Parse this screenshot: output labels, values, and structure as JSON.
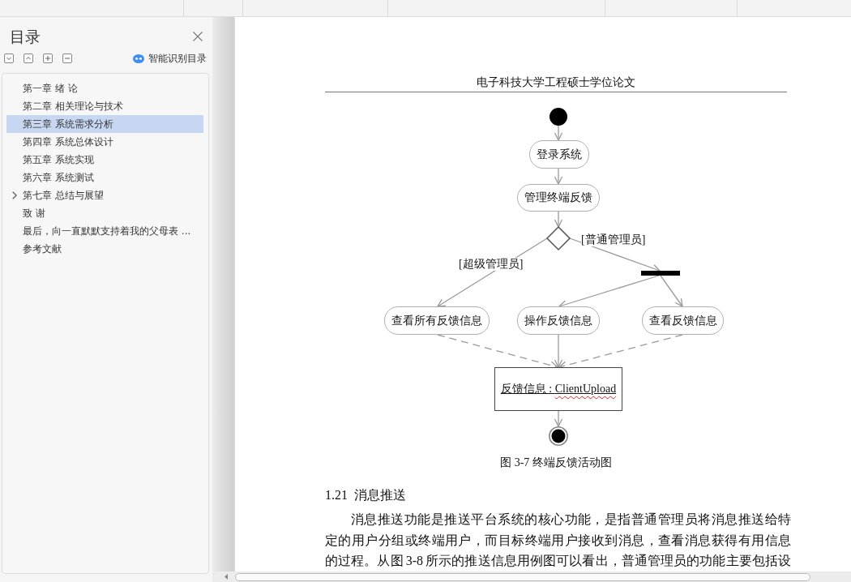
{
  "sidebar": {
    "title": "目录",
    "smart_toc_button": "智能识别目录",
    "items": [
      {
        "label": "第一章 绪 论",
        "selected": false,
        "expandable": false
      },
      {
        "label": "第二章 相关理论与技术",
        "selected": false,
        "expandable": false
      },
      {
        "label": "第三章 系统需求分析",
        "selected": true,
        "expandable": false
      },
      {
        "label": "第四章 系统总体设计",
        "selected": false,
        "expandable": false
      },
      {
        "label": "第五章 系统实现",
        "selected": false,
        "expandable": false
      },
      {
        "label": "第六章 系统测试",
        "selected": false,
        "expandable": false
      },
      {
        "label": "第七章 总结与展望",
        "selected": false,
        "expandable": true
      },
      {
        "label": "致 谢",
        "selected": false,
        "expandable": false
      },
      {
        "label": "最后，向一直默默支持着我的父母表 ...",
        "selected": false,
        "expandable": false
      },
      {
        "label": "参考文献",
        "selected": false,
        "expandable": false
      }
    ]
  },
  "document": {
    "header": "电子科技大学工程硕士学位论文",
    "figure": {
      "actions": [
        "登录系统",
        "管理终端反馈",
        "查看所有反馈信息",
        "操作反馈信息",
        "查看反馈信息"
      ],
      "guards": [
        "[普通管理员]",
        "[超级管理员]"
      ],
      "object": {
        "label": "反馈信息 : ClientUpload",
        "spell_flagged": true
      },
      "caption": "图 3-7 终端反馈活动图"
    },
    "section": {
      "number": "1.21",
      "title": "消息推送"
    },
    "paragraph": "消息推送功能是推送平台系统的核心功能，是指普通管理员将消息推送给特定的用户分组或终端用户，而目标终端用户接收到消息，查看消息获得有用信息的过程。从图 3-8 所示的推送信息用例图可以看出，普通管理员的功能主要包括设"
  }
}
